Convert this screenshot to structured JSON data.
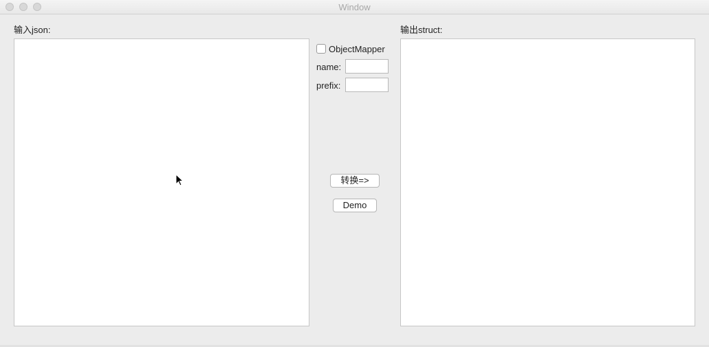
{
  "window": {
    "title": "Window"
  },
  "input_panel": {
    "label": "输入json:",
    "value": ""
  },
  "output_panel": {
    "label": "输出struct:",
    "value": ""
  },
  "options": {
    "objectmapper_label": "ObjectMapper",
    "objectmapper_checked": false,
    "name_label": "name:",
    "name_value": "",
    "prefix_label": "prefix:",
    "prefix_value": ""
  },
  "actions": {
    "convert_label": "转换=>",
    "demo_label": "Demo"
  }
}
